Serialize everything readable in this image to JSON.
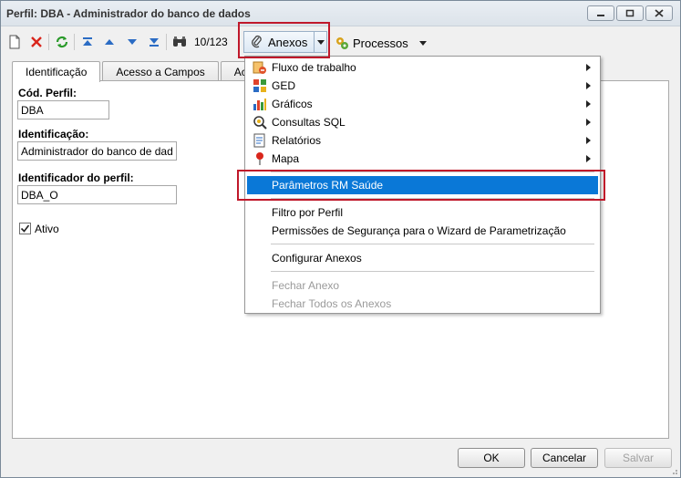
{
  "window": {
    "title": "Perfil: DBA - Administrador do banco de dados"
  },
  "toolbar": {
    "record_counter": "10/123",
    "anexos_label": "Anexos",
    "processos_label": "Processos"
  },
  "tabs": [
    {
      "label": "Identificação",
      "active": true
    },
    {
      "label": "Acesso a Campos",
      "active": false
    },
    {
      "label": "Ace",
      "active": false
    }
  ],
  "form": {
    "cod_perfil": {
      "label": "Cód. Perfil:",
      "value": "DBA"
    },
    "identificacao": {
      "label": "Identificação:",
      "value": "Administrador do banco de dados"
    },
    "identificador": {
      "label": "Identificador do perfil:",
      "value": "DBA_O"
    },
    "ativo": {
      "label": "Ativo",
      "checked": true
    }
  },
  "menu": {
    "items": [
      {
        "label": "Fluxo de trabalho",
        "icon": "workflow-icon",
        "submenu": true
      },
      {
        "label": "GED",
        "icon": "ged-icon",
        "submenu": true
      },
      {
        "label": "Gráficos",
        "icon": "bar-chart-icon",
        "submenu": true
      },
      {
        "label": "Consultas SQL",
        "icon": "sql-query-icon",
        "submenu": true
      },
      {
        "label": "Relatórios",
        "icon": "report-icon",
        "submenu": true
      },
      {
        "label": "Mapa",
        "icon": "map-pin-icon",
        "submenu": true
      },
      {
        "label": "Parâmetros RM Saúde",
        "selected": true
      },
      {
        "label": "Filtro por Perfil"
      },
      {
        "label": "Permissões de Segurança para o Wizard de Parametrização"
      },
      {
        "label": "Configurar Anexos"
      },
      {
        "label": "Fechar Anexo",
        "disabled": true
      },
      {
        "label": "Fechar Todos os Anexos",
        "disabled": true
      }
    ]
  },
  "buttons": {
    "ok": "OK",
    "cancel": "Cancelar",
    "save": "Salvar"
  },
  "colors": {
    "menu_selected": "#0a78d7",
    "highlight_red": "#c0182a"
  }
}
